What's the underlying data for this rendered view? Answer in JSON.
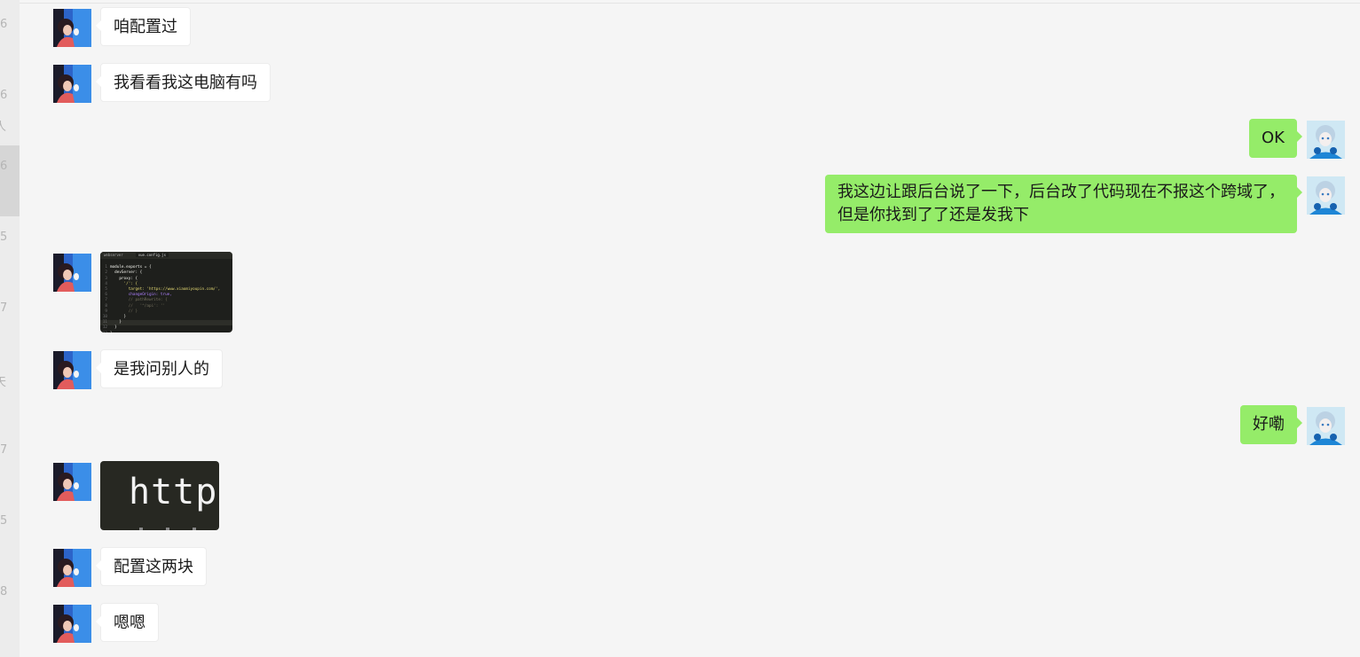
{
  "left_panel": {
    "fragments": [
      "6",
      "6",
      "人",
      "6",
      "5",
      "7",
      "天",
      "7",
      "5",
      "8"
    ]
  },
  "messages": [
    {
      "side": "in",
      "type": "text",
      "text": "咱配置过"
    },
    {
      "side": "in",
      "type": "text",
      "text": "我看看我这电脑有吗"
    },
    {
      "side": "out",
      "type": "text",
      "text": "OK"
    },
    {
      "side": "out",
      "type": "text",
      "lines": [
        "我这边让跟后台说了一下，后台改了代码现在不报这个跨域了，",
        "但是你找到了了还是发我下"
      ]
    },
    {
      "side": "in",
      "type": "image",
      "image_kind": "code-screenshot",
      "tabs": [
        "webserver",
        "vue.config.js"
      ],
      "code": [
        {
          "n": "1",
          "text": "module.exports = {"
        },
        {
          "n": "2",
          "text": "  devServer: {"
        },
        {
          "n": "3",
          "text": "    proxy: {"
        },
        {
          "n": "4",
          "text": "      '/': {"
        },
        {
          "n": "5",
          "text": "        target: 'https://www.xiaomiyoupin.com/',"
        },
        {
          "n": "6",
          "text": "        changeOrigin: true,"
        },
        {
          "n": "7",
          "text": "        // pathRewrite: {"
        },
        {
          "n": "8",
          "text": "        //   '^/api': ''"
        },
        {
          "n": "9",
          "text": "        // }"
        },
        {
          "n": "10",
          "text": "      }"
        },
        {
          "n": "11",
          "text": "    }"
        },
        {
          "n": "12",
          "text": "  }"
        },
        {
          "n": "13",
          "text": "}"
        }
      ]
    },
    {
      "side": "in",
      "type": "text",
      "text": "是我问别人的"
    },
    {
      "side": "out",
      "type": "text",
      "text": "好嘞"
    },
    {
      "side": "in",
      "type": "image",
      "image_kind": "code-zoom",
      "text": "http"
    },
    {
      "side": "in",
      "type": "text",
      "text": "配置这两块"
    },
    {
      "side": "in",
      "type": "text",
      "text": "嗯嗯"
    }
  ],
  "avatars": {
    "contact": "contact-avatar",
    "self": "self-avatar"
  },
  "colors": {
    "background": "#f5f5f5",
    "incoming_bubble": "#ffffff",
    "outgoing_bubble": "#95ec69",
    "text": "#1a1a1a"
  }
}
